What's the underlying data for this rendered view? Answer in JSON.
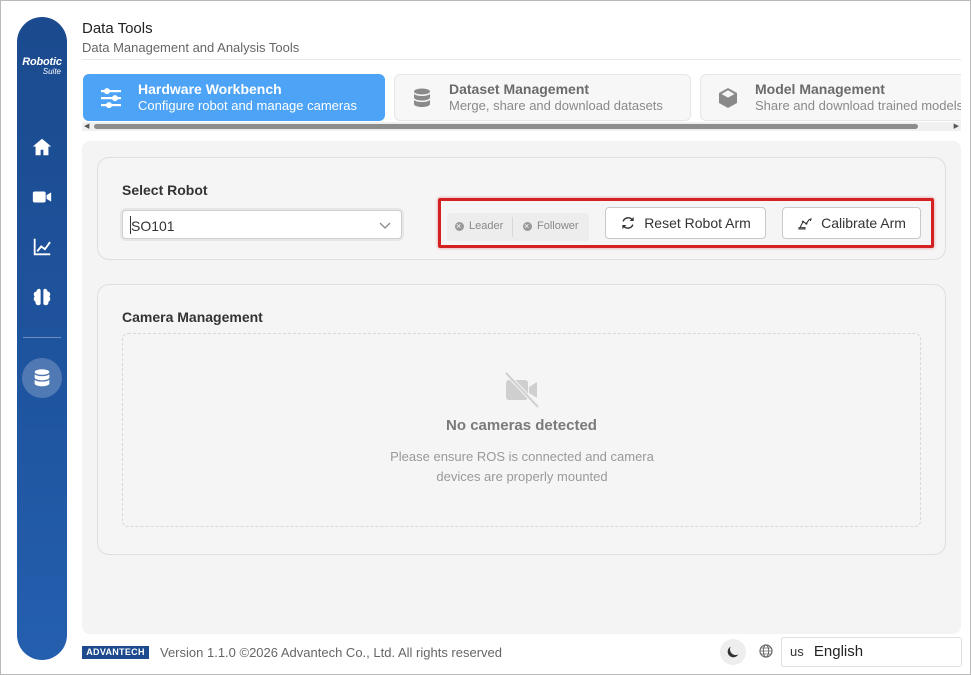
{
  "app": {
    "logo_line1": "Robotic",
    "logo_line2": "Suite",
    "title": "Data Tools",
    "subtitle": "Data Management and Analysis Tools"
  },
  "sidebar": {
    "items": [
      {
        "icon": "home-icon"
      },
      {
        "icon": "video-icon"
      },
      {
        "icon": "chart-icon"
      },
      {
        "icon": "brain-icon"
      },
      {
        "icon": "database-icon",
        "active": true
      }
    ]
  },
  "tabs": [
    {
      "title": "Hardware Workbench",
      "subtitle": "Configure robot and manage cameras",
      "icon": "sliders-icon",
      "active": true
    },
    {
      "title": "Dataset Management",
      "subtitle": "Merge, share and download datasets",
      "icon": "database-icon"
    },
    {
      "title": "Model Management",
      "subtitle": "Share and download trained models",
      "icon": "cube-icon"
    }
  ],
  "robot": {
    "section_title": "Select Robot",
    "selected": "SO101",
    "status": [
      {
        "label": "Leader"
      },
      {
        "label": "Follower"
      }
    ],
    "reset_label": "Reset Robot Arm",
    "calibrate_label": "Calibrate Arm"
  },
  "camera": {
    "section_title": "Camera Management",
    "empty_title": "No cameras detected",
    "empty_line1": "Please ensure ROS is connected and camera",
    "empty_line2": "devices are properly mounted"
  },
  "footer": {
    "brand": "ADVANTECH",
    "version": "Version 1.1.0 ©2026 Advantech Co., Ltd. All rights reserved",
    "lang_flag": "us",
    "lang_label": "English"
  },
  "colors": {
    "sidebar": "#1f55a0",
    "active_tab": "#4da3f6",
    "highlight": "#d42222"
  }
}
